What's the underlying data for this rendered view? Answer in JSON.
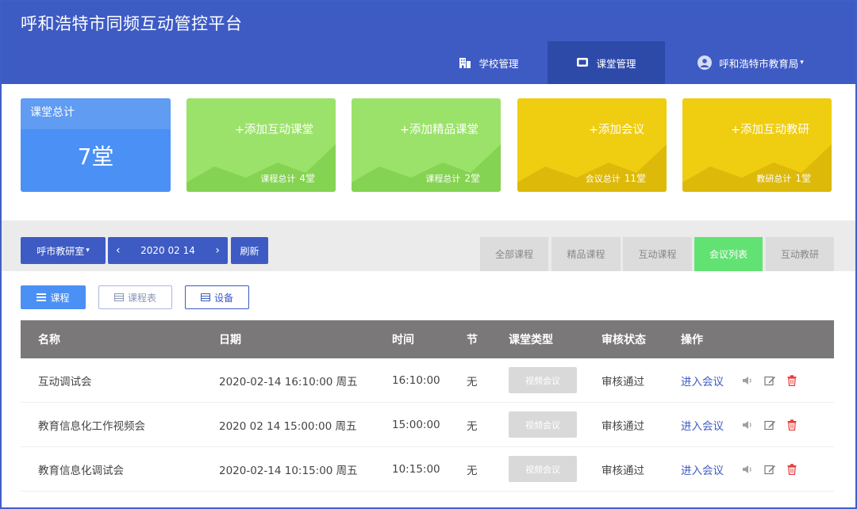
{
  "header": {
    "app_title": "呼和浩特市同频互动管控平台",
    "nav": [
      {
        "label": "学校管理",
        "icon": "building-icon"
      },
      {
        "label": "课堂管理",
        "icon": "monitor-icon"
      },
      {
        "label": "呼和浩特市教育局",
        "icon": "user-avatar-icon"
      }
    ]
  },
  "cards": {
    "total": {
      "title": "课堂总计",
      "value": "7堂"
    },
    "items": [
      {
        "add_label": "+添加互动课堂",
        "sum_label": "课程总计",
        "sum_value": "4堂",
        "color": "#9be26a"
      },
      {
        "add_label": "+添加精品课堂",
        "sum_label": "课程总计",
        "sum_value": "2堂",
        "color": "#9be26a"
      },
      {
        "add_label": "+添加会议",
        "sum_label": "会议总计",
        "sum_value": "11堂",
        "color": "#efcd10"
      },
      {
        "add_label": "+添加互动教研",
        "sum_label": "教研总计",
        "sum_value": "1堂",
        "color": "#efcd10"
      }
    ]
  },
  "toolbar": {
    "room": "呼市教研室",
    "date": "2020 02 14",
    "prev": "‹",
    "next": "›",
    "refresh": "刷新",
    "filters": [
      "全部课程",
      "精品课程",
      "互动课程",
      "会议列表",
      "互动教研"
    ],
    "active_filter": "会议列表"
  },
  "views": [
    "课程",
    "课程表",
    "设备"
  ],
  "table": {
    "headers": [
      "名称",
      "日期",
      "时间",
      "节",
      "课堂类型",
      "审核状态",
      "操作"
    ],
    "rows": [
      {
        "name": "互动调试会",
        "date": "2020-02-14 16:10:00 周五",
        "time": "16:10:00",
        "section": "无",
        "type": "视频会议",
        "status": "审核通过",
        "action": "进入会议"
      },
      {
        "name": "教育信息化工作视频会",
        "date": "2020 02 14 15:00:00 周五",
        "time": "15:00:00",
        "section": "无",
        "type": "视频会议",
        "status": "审核通过",
        "action": "进入会议"
      },
      {
        "name": "教育信息化调试会",
        "date": "2020-02-14 10:15:00 周五",
        "time": "10:15:00",
        "section": "无",
        "type": "视频会议",
        "status": "审核通过",
        "action": "进入会议"
      }
    ]
  },
  "colors": {
    "brand": "#3e5bc4",
    "brand_dark": "#2e4aa8",
    "total_card": "#4a90f5",
    "green_card": "#9be26a",
    "yellow_card": "#efcd10",
    "active_filter": "#62e272",
    "delete_icon": "#e53935"
  }
}
